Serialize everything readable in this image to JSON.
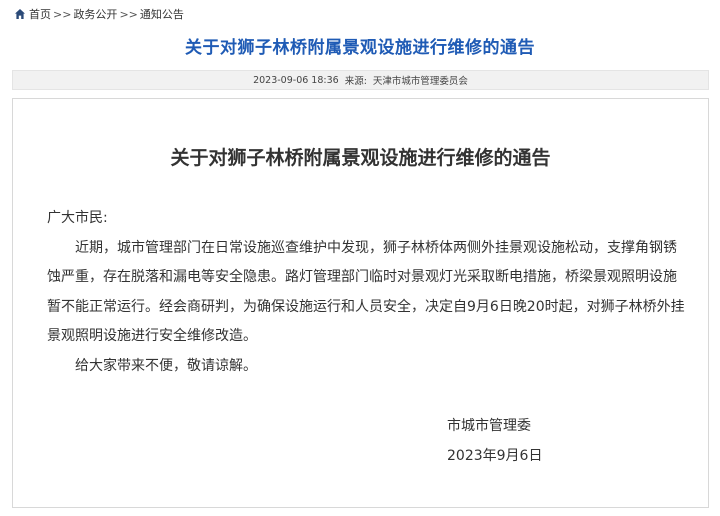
{
  "breadcrumb": {
    "home": "首页",
    "separator": ">>",
    "items": [
      "政务公开",
      "通知公告"
    ]
  },
  "header": {
    "title": "关于对狮子林桥附属景观设施进行维修的通告"
  },
  "meta": {
    "datetime": "2023-09-06 18:36",
    "source_label": "来源:",
    "source": "天津市城市管理委员会"
  },
  "article": {
    "title": "关于对狮子林桥附属景观设施进行维修的通告",
    "salutation": "广大市民:",
    "paragraphs": [
      "近期，城市管理部门在日常设施巡查维护中发现，狮子林桥体两侧外挂景观设施松动，支撑角钢锈蚀严重，存在脱落和漏电等安全隐患。路灯管理部门临时对景观灯光采取断电措施，桥梁景观照明设施暂不能正常运行。经会商研判，为确保设施运行和人员安全，决定自9月6日晚20时起，对狮子林桥外挂景观照明设施进行安全维修改造。",
      "给大家带来不便，敬请谅解。"
    ],
    "signature_org": "市城市管理委",
    "signature_date": "2023年9月6日"
  },
  "colors": {
    "title_blue": "#1f5bb5",
    "meta_bg": "#f1f1f1",
    "border": "#d8d8d8"
  }
}
